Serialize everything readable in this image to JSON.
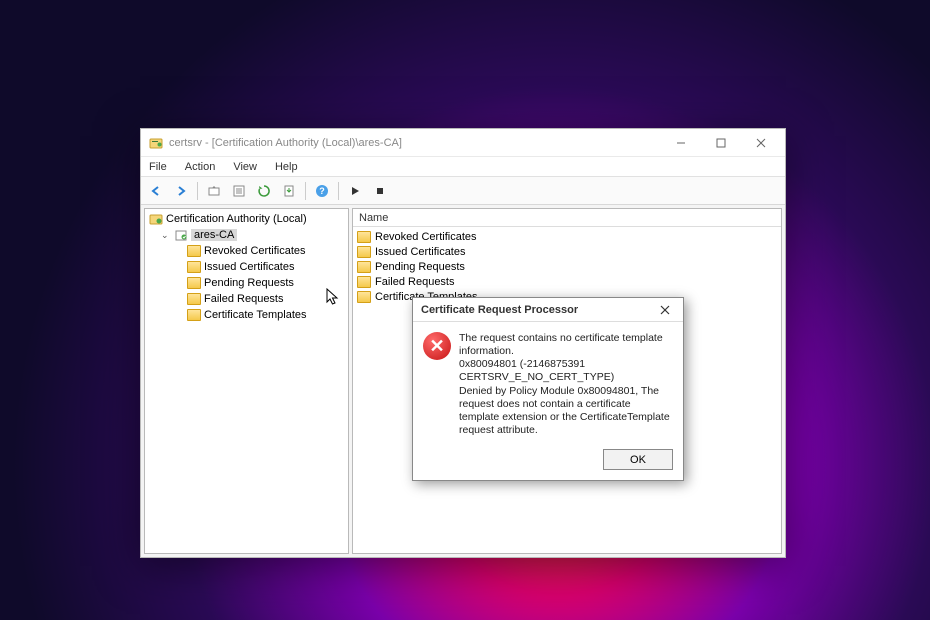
{
  "window": {
    "title": "certsrv - [Certification Authority (Local)\\ares-CA]",
    "menu": {
      "file": "File",
      "action": "Action",
      "view": "View",
      "help": "Help"
    }
  },
  "tree": {
    "root": "Certification Authority (Local)",
    "ca": "ares-CA",
    "items": [
      "Revoked Certificates",
      "Issued Certificates",
      "Pending Requests",
      "Failed Requests",
      "Certificate Templates"
    ]
  },
  "list": {
    "header": "Name",
    "items": [
      "Revoked Certificates",
      "Issued Certificates",
      "Pending Requests",
      "Failed Requests",
      "Certificate Templates"
    ]
  },
  "dialog": {
    "title": "Certificate Request Processor",
    "line1": "The request contains no certificate template information.",
    "line2": "0x80094801 (-2146875391 CERTSRV_E_NO_CERT_TYPE)",
    "line3": "Denied by Policy Module  0x80094801, The request does not contain a certificate template extension or the CertificateTemplate request attribute.",
    "ok": "OK"
  }
}
